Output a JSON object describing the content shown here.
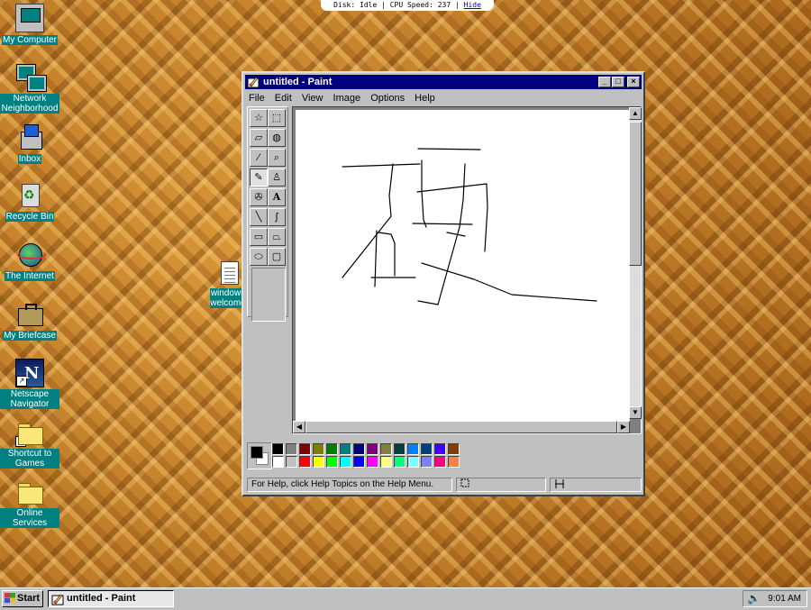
{
  "status_strip": {
    "text": "Disk: Idle | CPU Speed: 237 |",
    "hide_link": "Hide"
  },
  "desktop_icons": [
    {
      "name": "my-computer",
      "label": "My Computer"
    },
    {
      "name": "network-neighborhood",
      "label": "Network Neighborhood"
    },
    {
      "name": "inbox",
      "label": "Inbox"
    },
    {
      "name": "recycle-bin",
      "label": "Recycle Bin"
    },
    {
      "name": "the-internet",
      "label": "The Internet"
    },
    {
      "name": "my-briefcase",
      "label": "My Briefcase"
    },
    {
      "name": "netscape-navigator",
      "label": "Netscape Navigator"
    },
    {
      "name": "shortcut-to-games",
      "label": "Shortcut to Games"
    },
    {
      "name": "online-services",
      "label": "Online Services"
    }
  ],
  "welcome_icon": {
    "label1": "windows",
    "label2": "welcome"
  },
  "paint": {
    "title": "untitled - Paint",
    "menu": [
      "File",
      "Edit",
      "View",
      "Image",
      "Options",
      "Help"
    ],
    "tools": [
      "free-form-select",
      "select",
      "eraser",
      "fill-with-color",
      "pick-color",
      "magnifier",
      "pencil",
      "brush",
      "airbrush",
      "text",
      "line",
      "curve",
      "rectangle",
      "polygon",
      "ellipse",
      "rounded-rectangle"
    ],
    "active_tool": "pencil",
    "palette_top": [
      "#000000",
      "#808080",
      "#800000",
      "#808000",
      "#008000",
      "#008080",
      "#000080",
      "#800080",
      "#808040",
      "#004040",
      "#0080ff",
      "#004080",
      "#4000ff",
      "#804000"
    ],
    "palette_bottom": [
      "#ffffff",
      "#c0c0c0",
      "#ff0000",
      "#ffff00",
      "#00ff00",
      "#00ffff",
      "#0000ff",
      "#ff00ff",
      "#ffff80",
      "#00ff80",
      "#80ffff",
      "#8080ff",
      "#ff0080",
      "#ff8040"
    ],
    "foreground_color": "#000000",
    "background_color": "#ffffff",
    "status_text": "For Help, click Help Topics on the Help Menu."
  },
  "taskbar": {
    "start_label": "Start",
    "task_label": "untitled - Paint",
    "clock": "9:01 AM"
  }
}
